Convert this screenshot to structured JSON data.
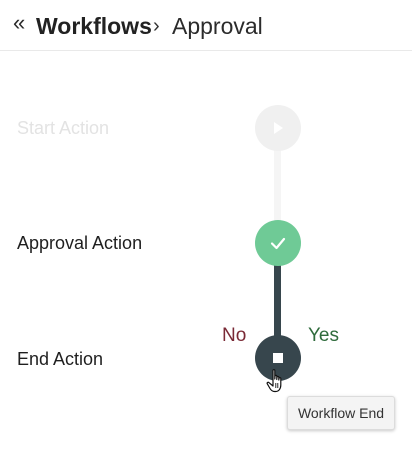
{
  "header": {
    "back_icon": "«",
    "parent": "Workflows",
    "separator": "›",
    "current": "Approval"
  },
  "steps": [
    {
      "label": "Start Action",
      "state": "disabled",
      "icon": "play-icon"
    },
    {
      "label": "Approval Action",
      "state": "done",
      "icon": "check-icon"
    },
    {
      "label": "End Action",
      "state": "current",
      "icon": "stop-icon"
    }
  ],
  "branches": {
    "no": "No",
    "yes": "Yes"
  },
  "tooltip": "Workflow End",
  "colors": {
    "done": "#6fca96",
    "current": "#37464d",
    "disabled": "#f0f0f0",
    "no": "#7a2a36",
    "yes": "#2f6b3c"
  }
}
